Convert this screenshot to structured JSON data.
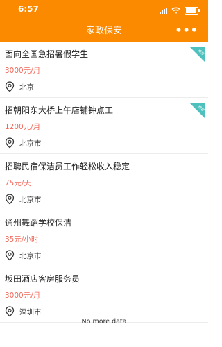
{
  "status_bar": {
    "time": "6:57",
    "icons": [
      "signal-icon",
      "wifi-icon",
      "battery-icon"
    ],
    "battery_level": 0.85
  },
  "header": {
    "title": "家政保安",
    "more_icon": "•••"
  },
  "colors": {
    "header_bg": "#fb8a00",
    "salary": "#f2695a",
    "tag": "#4ec0bd"
  },
  "jobs": [
    {
      "title": "面向全国急招暑假学生",
      "salary": "3000元/月",
      "location": "北京",
      "tag": "推荐"
    },
    {
      "title": "招朝阳东大桥上午店铺钟点工",
      "salary": "1200元/月",
      "location": "北京市",
      "tag": "推荐"
    },
    {
      "title": "招聘民宿保洁员工作轻松收入稳定",
      "salary": "75元/天",
      "location": "北京市"
    },
    {
      "title": "通州舞蹈学校保洁",
      "salary": "35元/小时",
      "location": "北京市"
    },
    {
      "title": "坂田酒店客房服务员",
      "salary": "3000元/月",
      "location": "深圳市"
    }
  ],
  "footer": {
    "no_more": "No more data"
  }
}
